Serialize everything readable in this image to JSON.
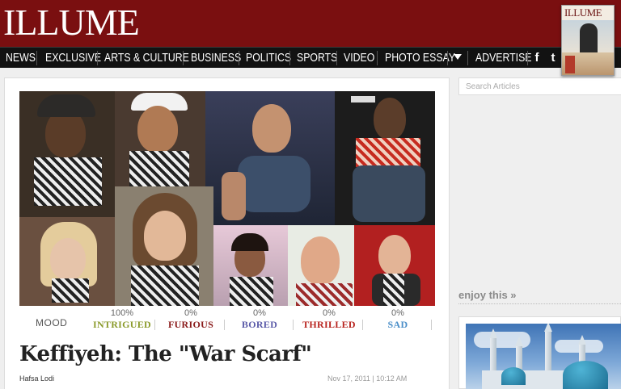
{
  "site": {
    "logo": "ILLUME",
    "magazine_title": "ILLUME"
  },
  "nav": {
    "items": [
      "NEWS",
      "EXCLUSIVE",
      "ARTS & CULTURE",
      "BUSINESS",
      "POLITICS",
      "SPORTS",
      "VIDEO",
      "PHOTO ESSAY",
      "ADVERTISE"
    ],
    "social": [
      "facebook-icon",
      "twitter-icon"
    ]
  },
  "search": {
    "placeholder": "Search Articles"
  },
  "mood": {
    "label": "MOOD",
    "items": [
      {
        "percent": "100%",
        "name": "INTRIGUED",
        "color": "#8a9a2a"
      },
      {
        "percent": "0%",
        "name": "FURIOUS",
        "color": "#8a1a1a"
      },
      {
        "percent": "0%",
        "name": "BORED",
        "color": "#5a5aa8"
      },
      {
        "percent": "0%",
        "name": "THRILLED",
        "color": "#b8231e"
      },
      {
        "percent": "0%",
        "name": "SAD",
        "color": "#4a8ec8"
      }
    ]
  },
  "article": {
    "title": "Keffiyeh: The \"War Scarf\"",
    "author": "Hafsa Lodi",
    "date": "Nov 17, 2011 | 10:12 AM"
  },
  "sidebar": {
    "enjoy": "enjoy this »"
  },
  "colors": {
    "header_bg": "#7a0f10",
    "nav_bg": "#121212"
  }
}
